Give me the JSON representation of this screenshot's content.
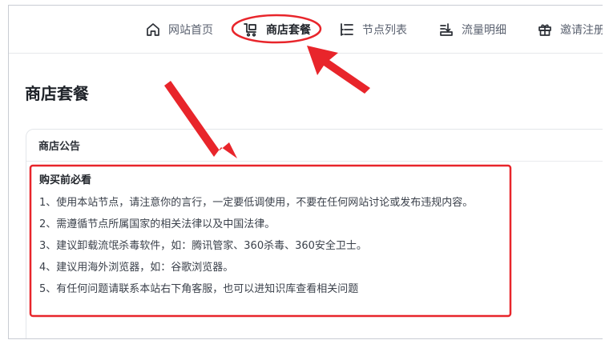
{
  "nav": {
    "items": [
      {
        "label": "网站首页",
        "icon": "home-icon"
      },
      {
        "label": "商店套餐",
        "icon": "cart-icon",
        "active": true
      },
      {
        "label": "节点列表",
        "icon": "list-icon"
      },
      {
        "label": "流量明细",
        "icon": "traffic-icon"
      },
      {
        "label": "邀请注册",
        "icon": "gift-icon"
      }
    ]
  },
  "page": {
    "title": "商店套餐"
  },
  "announcement": {
    "header": "商店公告",
    "title": "购买前必看",
    "items": [
      "1、使用本站节点，请注意你的言行，一定要低调使用，不要在任何网站讨论或发布违规内容。",
      "2、需遵循节点所属国家的相关法律以及中国法律。",
      "3、建议卸载流氓杀毒软件，如：腾讯管家、360杀毒、360安全卫士。",
      "4、建议用海外浏览器，如：谷歌浏览器。",
      "5、有任何问题请联系本站右下角客服，也可以进知识库查看相关问题"
    ]
  },
  "colors": {
    "annotation": "#e8252b",
    "text": "#1f2329",
    "muted": "#5b6270"
  }
}
